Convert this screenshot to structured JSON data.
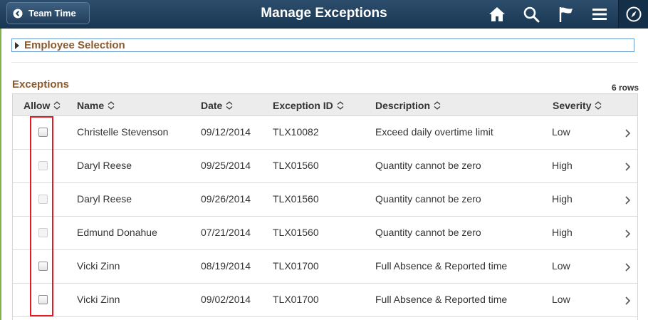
{
  "header": {
    "back_label": "Team Time",
    "title": "Manage Exceptions",
    "icons": [
      "home-icon",
      "search-icon",
      "flag-icon",
      "menu-icon",
      "navigator-icon"
    ],
    "banner_color": "#1f3f5e"
  },
  "employee_selection": {
    "label": "Employee Selection",
    "expanded": false
  },
  "exceptions": {
    "title": "Exceptions",
    "row_count": "6 rows",
    "columns": [
      "Allow",
      "Name",
      "Date",
      "Exception ID",
      "Description",
      "Severity"
    ],
    "rows": [
      {
        "allow_enabled": true,
        "allowed": false,
        "name": "Christelle Stevenson",
        "date": "09/12/2014",
        "exception_id": "TLX10082",
        "description": "Exceed daily overtime limit",
        "severity": "Low"
      },
      {
        "allow_enabled": false,
        "allowed": false,
        "name": "Daryl Reese",
        "date": "09/25/2014",
        "exception_id": "TLX01560",
        "description": "Quantity cannot be zero",
        "severity": "High"
      },
      {
        "allow_enabled": false,
        "allowed": false,
        "name": "Daryl Reese",
        "date": "09/26/2014",
        "exception_id": "TLX01560",
        "description": "Quantity cannot be zero",
        "severity": "High"
      },
      {
        "allow_enabled": false,
        "allowed": false,
        "name": "Edmund Donahue",
        "date": "07/21/2014",
        "exception_id": "TLX01560",
        "description": "Quantity cannot be zero",
        "severity": "High"
      },
      {
        "allow_enabled": true,
        "allowed": false,
        "name": "Vicki Zinn",
        "date": "08/19/2014",
        "exception_id": "TLX01700",
        "description": "Full Absence & Reported time",
        "severity": "Low"
      },
      {
        "allow_enabled": true,
        "allowed": false,
        "name": "Vicki Zinn",
        "date": "09/02/2014",
        "exception_id": "TLX01700",
        "description": "Full Absence & Reported time",
        "severity": "Low"
      }
    ]
  },
  "highlight_color": "#e31b23"
}
